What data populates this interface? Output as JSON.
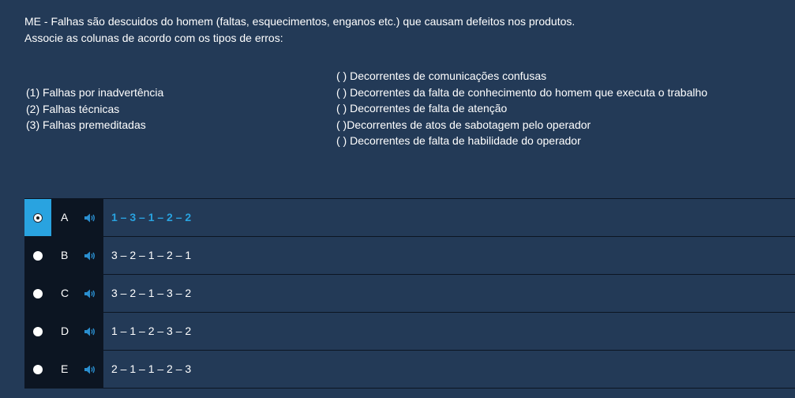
{
  "question": {
    "line1": "ME - Falhas são descuidos do homem (faltas, esquecimentos, enganos etc.) que causam defeitos nos produtos.",
    "line2": "Associe as colunas de acordo com os tipos de erros:"
  },
  "left_column": [
    "(1) Falhas por inadvertência",
    "(2) Falhas técnicas",
    "(3) Falhas premeditadas"
  ],
  "right_column": [
    "( ) Decorrentes de comunicações confusas",
    "( ) Decorrentes da falta de conhecimento do homem que executa o trabalho",
    "( ) Decorrentes de falta de atenção",
    "( )Decorrentes de atos de sabotagem pelo operador",
    "( ) Decorrentes de falta de habilidade do operador"
  ],
  "options": [
    {
      "letter": "A",
      "text": "1 – 3 – 1 – 2 – 2",
      "selected": true
    },
    {
      "letter": "B",
      "text": "3 – 2 – 1 – 2 – 1",
      "selected": false
    },
    {
      "letter": "C",
      "text": "3 – 2 – 1 – 3 – 2",
      "selected": false
    },
    {
      "letter": "D",
      "text": "1 – 1 – 2 – 3 – 2",
      "selected": false
    },
    {
      "letter": "E",
      "text": "2 – 1 – 1 – 2 – 3",
      "selected": false
    }
  ],
  "icons": {
    "speaker": "speaker-icon",
    "radio": "radio-icon"
  },
  "colors": {
    "background": "#233a57",
    "dark": "#0c1522",
    "accent": "#29a3e0",
    "speaker": "#2a8fd0"
  }
}
